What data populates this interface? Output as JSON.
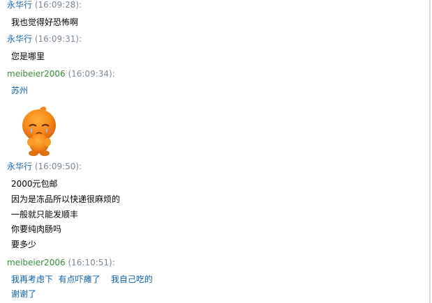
{
  "messages": [
    {
      "sender": "永华行",
      "time": "(16:09:28):",
      "lines": [
        "我也觉得好恐怖啊"
      ]
    },
    {
      "sender": "永华行",
      "time": "(16:09:31):",
      "lines": [
        "您是哪里"
      ]
    },
    {
      "sender": "meibeier2006",
      "time": "(16:09:34):",
      "lines": [
        "苏州"
      ],
      "emoji": "crying-orange-mascot-icon"
    },
    {
      "sender": "永华行",
      "time": "(16:09:50):",
      "lines": [
        "2000元包邮",
        "因为是冻品所以快递很麻烦的",
        "一般就只能发顺丰",
        "你要纯肉肠吗",
        "要多少"
      ]
    },
    {
      "sender": "meibeier2006",
      "time": "(16:10:51):",
      "lines": [
        "我再考虑下  有点吓瘫了    我自己吃的",
        "谢谢了"
      ]
    }
  ],
  "colors": {
    "seller_name": "#1d6aa8",
    "buyer_name": "#3b8c3b",
    "timestamp": "#7d8b97",
    "buyer_text": "#0b5ea8"
  }
}
